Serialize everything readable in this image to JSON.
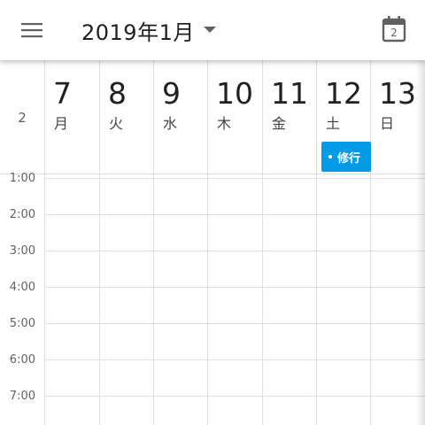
{
  "appbar": {
    "menu_icon": "hamburger-menu-icon",
    "title": "2019年1月",
    "dropdown_icon": "caret-down-icon",
    "today_icon": "calendar-today-icon",
    "today_number": "2"
  },
  "week": {
    "number": "2",
    "days": [
      {
        "num": "7",
        "weekday": "月"
      },
      {
        "num": "8",
        "weekday": "火"
      },
      {
        "num": "9",
        "weekday": "水"
      },
      {
        "num": "10",
        "weekday": "木"
      },
      {
        "num": "11",
        "weekday": "金"
      },
      {
        "num": "12",
        "weekday": "土"
      },
      {
        "num": "13",
        "weekday": "日"
      }
    ]
  },
  "event": {
    "title": "修行",
    "color": "#039be5"
  },
  "times": [
    "1:00",
    "2:00",
    "3:00",
    "4:00",
    "5:00",
    "6:00",
    "7:00"
  ],
  "colors": {
    "grid": "#e0e0e0",
    "text_primary": "#212121",
    "text_secondary": "#616161"
  }
}
